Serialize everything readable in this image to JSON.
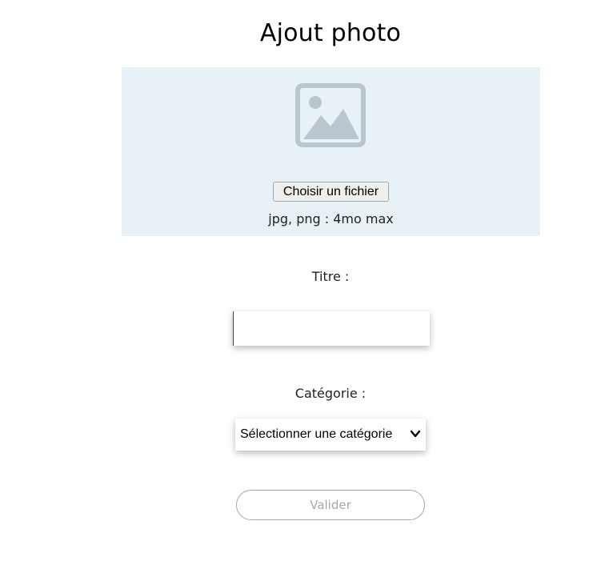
{
  "modal": {
    "title": "Ajout photo"
  },
  "upload": {
    "icon": "image-placeholder-icon",
    "choose_file_label": "Choisir un fichier",
    "hint": "jpg, png : 4mo max",
    "zone_color": "#e8f1f6",
    "icon_color": "#b9c6d0"
  },
  "form": {
    "title_label": "Titre :",
    "title_value": "",
    "category_label": "Catégorie :",
    "category_selected": "Sélectionner une catégorie",
    "submit_label": "Valider",
    "submit_disabled_color": "#a7a7a7"
  }
}
